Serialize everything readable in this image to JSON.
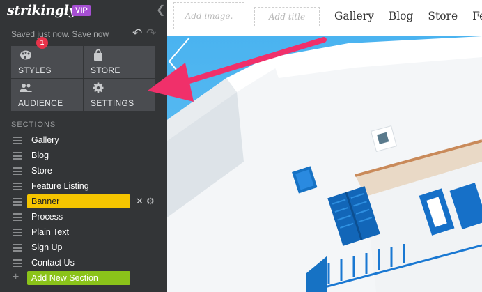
{
  "sidebar": {
    "logo": "strikingly",
    "vip_badge": "VIP",
    "status": "Saved just now.",
    "save_link": "Save now",
    "tiles": [
      {
        "label": "STYLES",
        "icon": "palette-icon"
      },
      {
        "label": "STORE",
        "icon": "shopping-bag-icon"
      },
      {
        "label": "AUDIENCE",
        "icon": "people-icon",
        "badge": "1"
      },
      {
        "label": "SETTINGS",
        "icon": "gear-icon"
      }
    ],
    "sections_title": "SECTIONS",
    "sections": [
      {
        "name": "Gallery"
      },
      {
        "name": "Blog"
      },
      {
        "name": "Store"
      },
      {
        "name": "Feature Listing"
      },
      {
        "name": "Banner",
        "active": true
      },
      {
        "name": "Process"
      },
      {
        "name": "Plain Text"
      },
      {
        "name": "Sign Up"
      },
      {
        "name": "Contact Us"
      }
    ],
    "add_section": "Add New Section"
  },
  "header": {
    "add_image": "Add image.",
    "add_title": "Add title",
    "nav": [
      "Gallery",
      "Blog",
      "Store",
      "Fea"
    ]
  },
  "colors": {
    "sidebar_bg": "#333537",
    "tile_bg": "#4a4c50",
    "vip": "#a64fd3",
    "active_section": "#f6c500",
    "add_section": "#8bc31a",
    "badge": "#e8334a",
    "annotation_arrow": "#f0306a",
    "sky": "#4ab3f0"
  }
}
